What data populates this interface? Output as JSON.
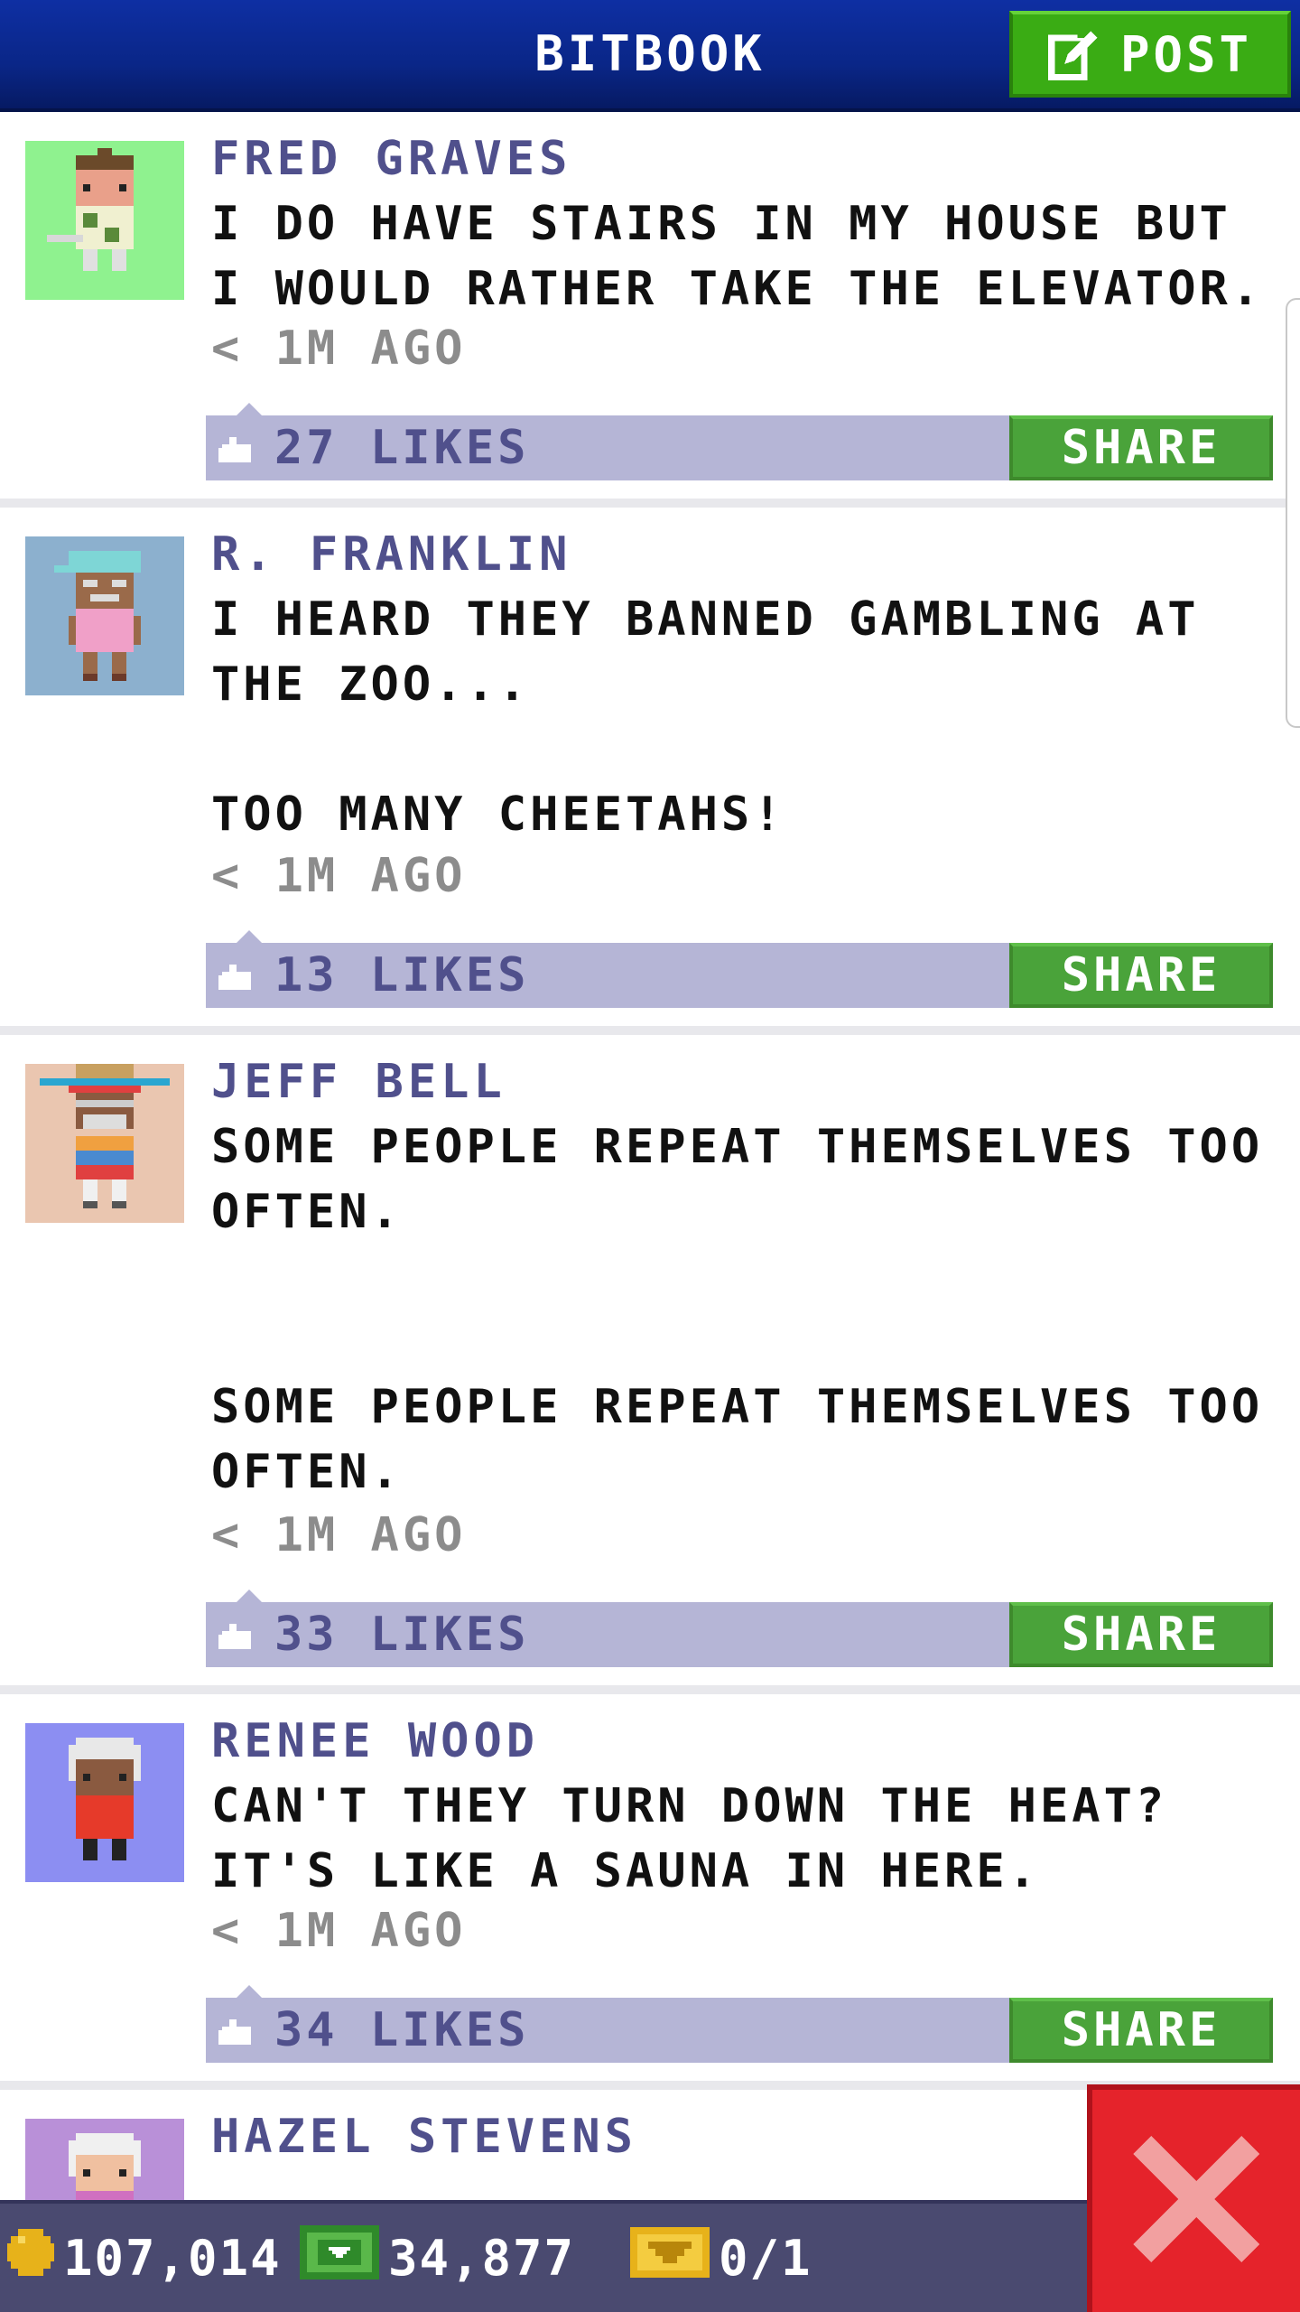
{
  "header": {
    "title": "BITBOOK",
    "post_label": "POST"
  },
  "posts": [
    {
      "name": "FRED GRAVES",
      "body": "I DO HAVE STAIRS IN MY HOUSE BUT I WOULD RATHER TAKE THE ELEVATOR.",
      "time": "< 1M AGO",
      "likes": "27 LIKES",
      "share": "SHARE",
      "avatar_bg": "#8ff28f"
    },
    {
      "name": "R. FRANKLIN",
      "body": "I HEARD THEY BANNED GAMBLING AT THE ZOO...\n\nTOO MANY CHEETAHS!",
      "time": "< 1M AGO",
      "likes": "13 LIKES",
      "share": "SHARE",
      "avatar_bg": "#8cb0ce"
    },
    {
      "name": "JEFF BELL",
      "body": "SOME PEOPLE REPEAT THEMSELVES TOO OFTEN.\n\n\nSOME PEOPLE REPEAT THEMSELVES TOO OFTEN.",
      "time": "< 1M AGO",
      "likes": "33 LIKES",
      "share": "SHARE",
      "avatar_bg": "#eac6b0"
    },
    {
      "name": "RENEE WOOD",
      "body": "CAN'T THEY TURN DOWN THE HEAT? IT'S LIKE A SAUNA IN HERE.",
      "time": "< 1M AGO",
      "likes": "34 LIKES",
      "share": "SHARE",
      "avatar_bg": "#8c8ef2"
    },
    {
      "name": "HAZEL STEVENS",
      "avatar_bg": "#b990d8"
    }
  ],
  "status": {
    "coins": "107,014",
    "bux": "34,877",
    "tickets": "0/1"
  },
  "colors": {
    "header": "#0a2687",
    "accent_green": "#3aac14",
    "likes_bar": "#b5b5d6",
    "name_text": "#50508c",
    "close_red": "#e5232b",
    "status_bar": "#4a4a70"
  }
}
